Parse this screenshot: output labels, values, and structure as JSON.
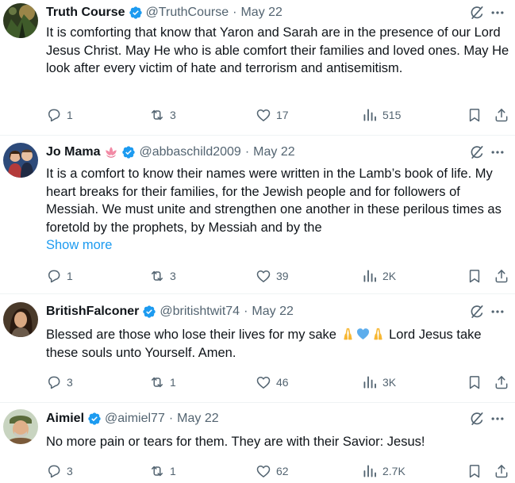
{
  "tweets": [
    {
      "name": "Truth Course",
      "handle": "@TruthCourse",
      "date": "May 22",
      "text": "It is comforting that know that Yaron and Sarah are in the presence of our Lord Jesus Christ. May He who is able comfort their families and loved ones. May He look after every victim of hate and terrorism and antisemitism.",
      "replies": "1",
      "reposts": "3",
      "likes": "17",
      "views": "515"
    },
    {
      "name": "Jo Mama",
      "handle": "@abbaschild2009",
      "date": "May 22",
      "text": "It is a comfort to know their names were written in the Lamb’s book of life. My heart breaks for their families, for the Jewish people and for followers of Messiah. We must unite and strengthen one another in these perilous times as foretold by the prophets, by Messiah and by the",
      "show_more": "Show more",
      "replies": "1",
      "reposts": "3",
      "likes": "39",
      "views": "2K"
    },
    {
      "name": "BritishFalconer",
      "handle": "@britishtwit74",
      "date": "May 22",
      "text_before": "Blessed are those who lose their lives for my sake ",
      "text_after": " Lord Jesus take these souls unto Yourself. Amen.",
      "replies": "3",
      "reposts": "1",
      "likes": "46",
      "views": "3K"
    },
    {
      "name": "Aimiel",
      "handle": "@aimiel77",
      "date": "May 22",
      "text": "No more pain or tears for them. They are with their Savior: Jesus!",
      "replies": "3",
      "reposts": "1",
      "likes": "62",
      "views": "2.7K"
    }
  ],
  "separator": "·",
  "colors": {
    "text": "#0f1419",
    "secondary": "#536471",
    "verified": "#1d9bf0",
    "link": "#1d9bf0",
    "divider": "#eff3f4"
  },
  "icons": [
    "verified-badge-icon",
    "grok-icon",
    "more-icon",
    "reply-icon",
    "repost-icon",
    "like-icon",
    "views-icon",
    "bookmark-icon",
    "share-icon",
    "lotus-emoji",
    "praying-hands-emoji",
    "blue-heart-emoji"
  ]
}
